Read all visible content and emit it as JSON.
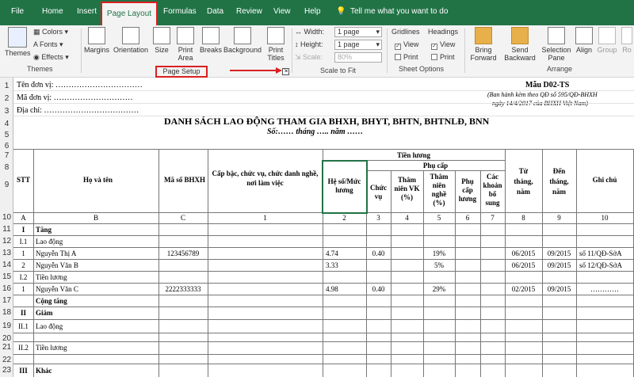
{
  "menu": {
    "file": "File",
    "home": "Home",
    "insert": "Insert",
    "page_layout": "Page Layout",
    "formulas": "Formulas",
    "data": "Data",
    "review": "Review",
    "view": "View",
    "help": "Help",
    "tellme": "Tell me what you want to do"
  },
  "ribbon": {
    "themes": "Themes",
    "colors": "Colors",
    "fonts": "Fonts",
    "effects": "Effects",
    "themes_group": "Themes",
    "margins": "Margins",
    "orientation": "Orientation",
    "size": "Size",
    "print_area": "Print Area",
    "breaks": "Breaks",
    "background": "Background",
    "print_titles": "Print Titles",
    "page_setup_group": "Page Setup",
    "width_label": "Width:",
    "width_value": "1 page",
    "height_label": "Height:",
    "height_value": "1 page",
    "scale_label": "Scale:",
    "scale_value": "80%",
    "scale_group": "Scale to Fit",
    "gridlines": "Gridlines",
    "headings": "Headings",
    "view1": "View",
    "print1": "Print",
    "view2": "View",
    "print2": "Print",
    "sheet_options_group": "Sheet Options",
    "bring_forward": "Bring Forward",
    "send_backward": "Send Backward",
    "selection_pane": "Selection Pane",
    "align": "Align",
    "group": "Group",
    "rotate": "Ro",
    "arrange_group": "Arrange"
  },
  "rows": [
    "1",
    "2",
    "3",
    "4",
    "5",
    "6",
    "7",
    "8",
    "9",
    "10",
    "11",
    "12",
    "13",
    "14",
    "15",
    "16",
    "17",
    "18",
    "19",
    "20",
    "21",
    "22",
    "23"
  ],
  "sheet": {
    "unit": "Tên đơn vị: ……………………………",
    "code": "Mã đơn vị: …………………………",
    "address": "Địa chỉ: ………………………………",
    "form": "Mẫu D02-TS",
    "note1": "(Ban hành kèm theo QĐ số 595/QĐ-BHXH",
    "note2": "ngày 14/4/2017 của BHXH Việt Nam)",
    "title": "DANH SÁCH LAO ĐỘNG THAM GIA BHXH, BHYT, BHTN, BHTNLĐ, BNN",
    "subtitle": "Số:…… tháng ….. năm ……",
    "h_stt": "STT",
    "h_name": "Họ và tên",
    "h_code": "Mã số BHXH",
    "h_pos1": "Cấp bậc, chức vụ, chức danh nghề,",
    "h_pos2": "nơi làm việc",
    "h_salary": "Tiền lương",
    "h_coef1": "Hệ số/Mức",
    "h_coef2": "lương",
    "h_allow": "Phụ cấp",
    "h_cv1": "Chức",
    "h_cv2": "vụ",
    "h_tn1": "Thâm",
    "h_tn2": "niên VK",
    "h_tn3": "(%)",
    "h_tnn1": "Thâm",
    "h_tnn2": "niên",
    "h_tnn3": "nghề",
    "h_tnn4": "(%)",
    "h_pc1": "Phụ",
    "h_pc2": "cấp",
    "h_pc3": "lương",
    "h_k1": "Các",
    "h_k2": "khoản",
    "h_k3": "bổ",
    "h_k4": "sung",
    "h_from1": "Từ",
    "h_from2": "tháng,",
    "h_from3": "năm",
    "h_to1": "Đến",
    "h_to2": "tháng,",
    "h_to3": "năm",
    "h_note": "Ghi chú",
    "i_a": "A",
    "i_b": "B",
    "i_c": "C",
    "i_1": "1",
    "i_2": "2",
    "i_3": "3",
    "i_4": "4",
    "i_5": "5",
    "i_6": "6",
    "i_7": "7",
    "i_8": "8",
    "i_9": "9",
    "i_10": "10",
    "r11_stt": "I",
    "r11_name": "Tăng",
    "r12_stt": "I.1",
    "r12_name": "Lao động",
    "r13_stt": "1",
    "r13_name": "Nguyễn Thị A",
    "r13_code": "123456789",
    "r13_coef": "4.74",
    "r13_cv": "0.40",
    "r13_tnn": "19%",
    "r13_from": "06/2015",
    "r13_to": "09/2015",
    "r13_note": "số 11/QĐ-SởA",
    "r14_stt": "2",
    "r14_name": "Nguyễn Văn B",
    "r14_coef": "3.33",
    "r14_tnn": "5%",
    "r14_from": "06/2015",
    "r14_to": "09/2015",
    "r14_note": "số 12/QĐ-SởA",
    "r15_stt": "I.2",
    "r15_name": "Tiền lương",
    "r16_stt": "1",
    "r16_name": "Nguyễn Văn C",
    "r16_code": "2222333333",
    "r16_coef": "4.98",
    "r16_cv": "0.40",
    "r16_tnn": "29%",
    "r16_from": "02/2015",
    "r16_to": "09/2015",
    "r16_note": "…………",
    "r17_name": "Cộng tăng",
    "r18_stt": "II",
    "r18_name": "Giảm",
    "r19_stt": "II.1",
    "r19_name": "Lao động",
    "r21_stt": "II.2",
    "r21_name": "Tiền lương",
    "r23_stt": "III",
    "r23_name": "Khác"
  }
}
